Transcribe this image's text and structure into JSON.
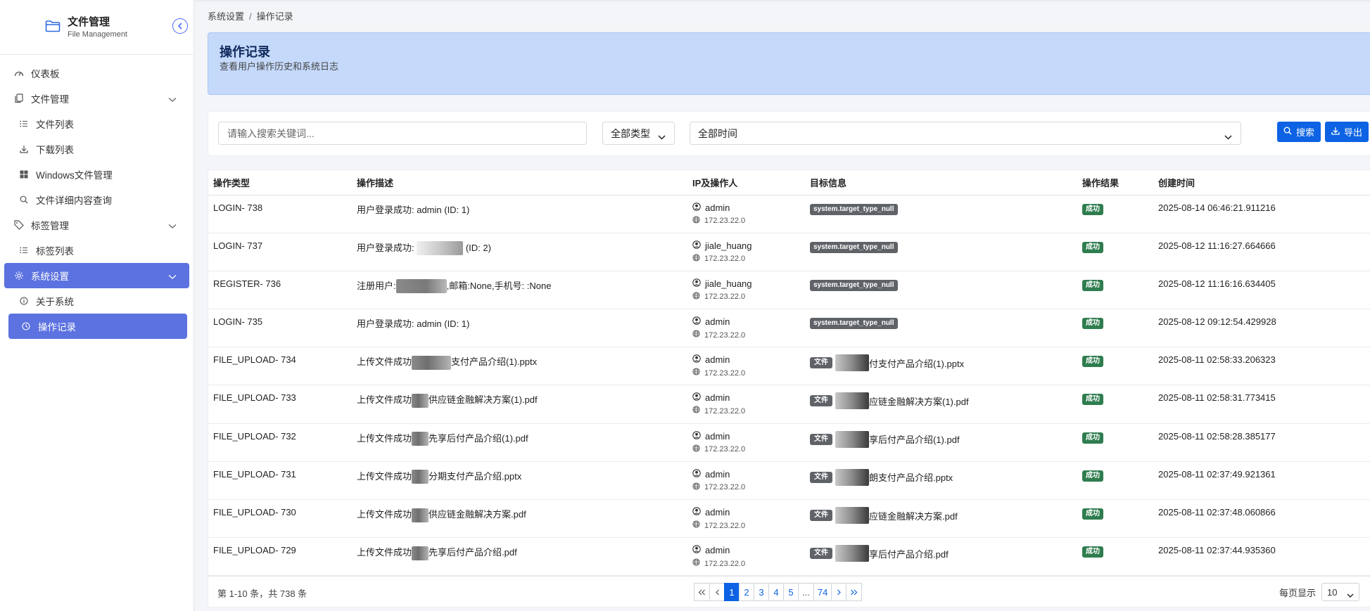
{
  "app": {
    "title": "文件管理",
    "subtitle": "File Management"
  },
  "sidebar": {
    "items": [
      {
        "label": "仪表板",
        "icon": "dashboard-icon"
      },
      {
        "label": "文件管理",
        "icon": "file-icon"
      },
      {
        "label": "文件列表",
        "icon": "list-icon"
      },
      {
        "label": "下载列表",
        "icon": "download-icon"
      },
      {
        "label": "Windows文件管理",
        "icon": "windows-icon"
      },
      {
        "label": "文件详细内容查询",
        "icon": "search-icon"
      },
      {
        "label": "标签管理",
        "icon": "tag-icon"
      },
      {
        "label": "标签列表",
        "icon": "list-icon"
      },
      {
        "label": "系统设置",
        "icon": "gear-icon"
      },
      {
        "label": "关于系统",
        "icon": "info-icon"
      },
      {
        "label": "操作记录",
        "icon": "clock-icon"
      }
    ]
  },
  "breadcrumb": {
    "parent": "系统设置",
    "sep": "/",
    "current": "操作记录"
  },
  "banner": {
    "title": "操作记录",
    "subtitle": "查看用户操作历史和系统日志"
  },
  "filters": {
    "search_placeholder": "请输入搜索关键词...",
    "type_value": "全部类型",
    "time_value": "全部时间",
    "search_label": "搜索",
    "export_label": "导出"
  },
  "table": {
    "headers": [
      "操作类型",
      "操作描述",
      "IP及操作人",
      "目标信息",
      "操作结果",
      "创建时间"
    ],
    "rows": [
      {
        "type": "LOGIN- 738",
        "desc_pre": "用户登录成功: admin (ID: 1)",
        "desc_post": "",
        "user": "admin",
        "ip": "172.23.22.0",
        "target_kind": "null",
        "target_tag": "system.target_type_null",
        "target_text": "",
        "result": "成功",
        "time": "2025-08-14 06:46:21.911216"
      },
      {
        "type": "LOGIN- 737",
        "desc_pre": "用户登录成功: ",
        "desc_post": " (ID: 2)",
        "user": "jiale_huang",
        "ip": "172.23.22.0",
        "target_kind": "null",
        "target_tag": "system.target_type_null",
        "target_text": "",
        "result": "成功",
        "time": "2025-08-12 11:16:27.664666"
      },
      {
        "type": "REGISTER- 736",
        "desc_pre": "注册用户:",
        "desc_post": ",邮箱:None,手机号: :None",
        "user": "jiale_huang",
        "ip": "172.23.22.0",
        "target_kind": "null",
        "target_tag": "system.target_type_null",
        "target_text": "",
        "result": "成功",
        "time": "2025-08-12 11:16:16.634405"
      },
      {
        "type": "LOGIN- 735",
        "desc_pre": "用户登录成功: admin (ID: 1)",
        "desc_post": "",
        "user": "admin",
        "ip": "172.23.22.0",
        "target_kind": "null",
        "target_tag": "system.target_type_null",
        "target_text": "",
        "result": "成功",
        "time": "2025-08-12 09:12:54.429928"
      },
      {
        "type": "FILE_UPLOAD- 734",
        "desc_pre": "上传文件成功",
        "desc_post": "支付产品介绍(1).pptx",
        "user": "admin",
        "ip": "172.23.22.0",
        "target_kind": "file",
        "target_tag": "文件",
        "target_text": "付支付产品介绍(1).pptx",
        "result": "成功",
        "time": "2025-08-11 02:58:33.206323"
      },
      {
        "type": "FILE_UPLOAD- 733",
        "desc_pre": "上传文件成功",
        "desc_post": "供应链金融解决方案(1).pdf",
        "user": "admin",
        "ip": "172.23.22.0",
        "target_kind": "file",
        "target_tag": "文件",
        "target_text": "应链金融解决方案(1).pdf",
        "result": "成功",
        "time": "2025-08-11 02:58:31.773415"
      },
      {
        "type": "FILE_UPLOAD- 732",
        "desc_pre": "上传文件成功",
        "desc_post": "先享后付产品介绍(1).pdf",
        "user": "admin",
        "ip": "172.23.22.0",
        "target_kind": "file",
        "target_tag": "文件",
        "target_text": "享后付产品介绍(1).pdf",
        "result": "成功",
        "time": "2025-08-11 02:58:28.385177"
      },
      {
        "type": "FILE_UPLOAD- 731",
        "desc_pre": "上传文件成功",
        "desc_post": "分期支付产品介绍.pptx",
        "user": "admin",
        "ip": "172.23.22.0",
        "target_kind": "file",
        "target_tag": "文件",
        "target_text": "朗支付产品介绍.pptx",
        "result": "成功",
        "time": "2025-08-11 02:37:49.921361"
      },
      {
        "type": "FILE_UPLOAD- 730",
        "desc_pre": "上传文件成功",
        "desc_post": "供应链金融解决方案.pdf",
        "user": "admin",
        "ip": "172.23.22.0",
        "target_kind": "file",
        "target_tag": "文件",
        "target_text": "应链金融解决方案.pdf",
        "result": "成功",
        "time": "2025-08-11 02:37:48.060866"
      },
      {
        "type": "FILE_UPLOAD- 729",
        "desc_pre": "上传文件成功",
        "desc_post": "先享后付产品介绍.pdf",
        "user": "admin",
        "ip": "172.23.22.0",
        "target_kind": "file",
        "target_tag": "文件",
        "target_text": "享后付产品介绍.pdf",
        "result": "成功",
        "time": "2025-08-11 02:37:44.935360"
      }
    ]
  },
  "pagination": {
    "info": "第 1-10 条，共 738 条",
    "pages": [
      "1",
      "2",
      "3",
      "4",
      "5",
      "...",
      "74"
    ],
    "current": "1",
    "per_page_label": "每页显示",
    "per_page_value": "10"
  },
  "colors": {
    "accent": "#5c72e0",
    "primary": "#0d63e3",
    "success": "#2f7d4f",
    "banner": "#c5d9fb"
  }
}
